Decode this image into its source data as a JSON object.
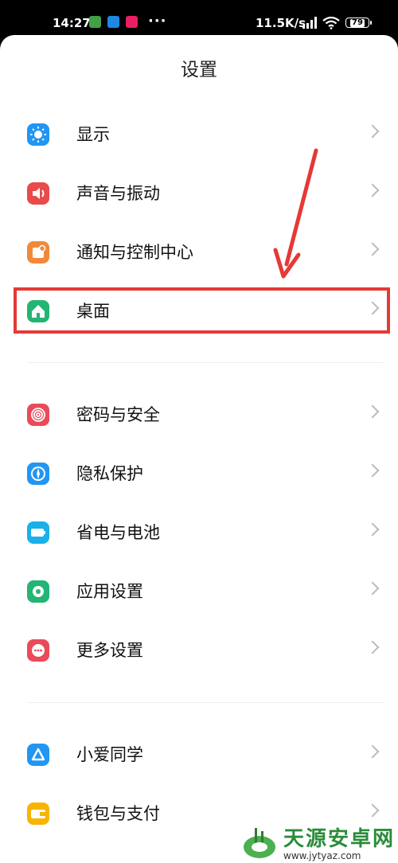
{
  "status_bar": {
    "time": "14:27",
    "dots": "···",
    "network_speed": "11.5K/s",
    "battery": "79",
    "app_icons": [
      {
        "name": "app-notif-icon-1",
        "color": "#43a047"
      },
      {
        "name": "app-notif-icon-2",
        "color": "#1e88e5"
      },
      {
        "name": "app-notif-icon-3",
        "color": "#e91e63"
      }
    ]
  },
  "page": {
    "title": "设置"
  },
  "groups": [
    [
      {
        "label": "显示",
        "icon": "brightness-icon",
        "color": "#2196f3"
      },
      {
        "label": "声音与振动",
        "icon": "speaker-icon",
        "color": "#e94b4b"
      },
      {
        "label": "通知与控制中心",
        "icon": "notification-icon",
        "color": "#f08a3a"
      },
      {
        "label": "桌面",
        "icon": "home-icon",
        "color": "#22b573"
      }
    ],
    [
      {
        "label": "密码与安全",
        "icon": "fingerprint-icon",
        "color": "#e94b5a"
      },
      {
        "label": "隐私保护",
        "icon": "privacy-compass-icon",
        "color": "#2196f3"
      },
      {
        "label": "省电与电池",
        "icon": "battery-icon",
        "color": "#1ab0e8"
      },
      {
        "label": "应用设置",
        "icon": "gear-icon",
        "color": "#22b573"
      },
      {
        "label": "更多设置",
        "icon": "more-icon",
        "color": "#e94b5a"
      }
    ],
    [
      {
        "label": "小爱同学",
        "icon": "xiaoai-icon",
        "color": "#2196f3"
      },
      {
        "label": "钱包与支付",
        "icon": "wallet-icon",
        "color": "#f7b500"
      }
    ]
  ],
  "watermark": {
    "text": "天源安卓网",
    "url": "www.jytyaz.com"
  }
}
